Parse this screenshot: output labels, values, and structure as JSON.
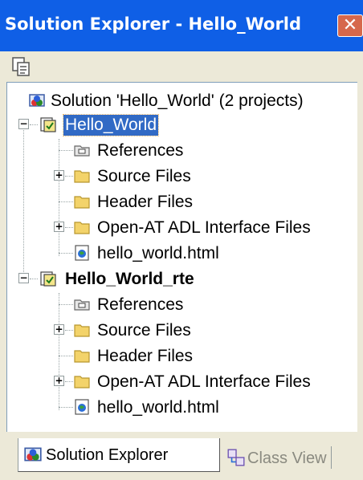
{
  "window": {
    "title": "Solution Explorer - Hello_World",
    "close_symbol": "✕"
  },
  "toolbar": {
    "properties_icon": "properties-icon"
  },
  "tree": {
    "solution": "Solution 'Hello_World' (2 projects)",
    "projects": [
      {
        "name": "Hello_World",
        "selected": true,
        "items": [
          "References",
          "Source Files",
          "Header Files",
          "Open-AT ADL Interface Files",
          "hello_world.html"
        ]
      },
      {
        "name": "Hello_World_rte",
        "bold": true,
        "items": [
          "References",
          "Source Files",
          "Header Files",
          "Open-AT ADL Interface Files",
          "hello_world.html"
        ]
      }
    ]
  },
  "tabs": {
    "solution_explorer": "Solution Explorer",
    "class_view": "Class View"
  },
  "colors": {
    "title_bar": "#0f5fe6",
    "selection": "#316ac5",
    "folder": "#f3d36a"
  }
}
